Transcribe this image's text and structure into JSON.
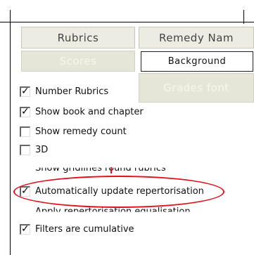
{
  "buttons": {
    "rubrics": "Rubrics",
    "remedy_name": "Remedy Nam",
    "scores": "Scores",
    "background": "Background",
    "grades_font": "Grades font"
  },
  "options": [
    {
      "label": "Number Rubrics",
      "checked": true
    },
    {
      "label": "Show book and chapter",
      "checked": true
    },
    {
      "label": "Show remedy count",
      "checked": false
    },
    {
      "label": "3D",
      "checked": false
    },
    {
      "label": "Show gridlines round rubrics",
      "checked": false
    },
    {
      "label": "Automatically update repertorisation",
      "checked": true
    },
    {
      "label": "Apply repertorisation equalisation",
      "checked": false
    },
    {
      "label": "Filters are cumulative",
      "checked": true
    }
  ],
  "highlight_color": "#e0101a"
}
